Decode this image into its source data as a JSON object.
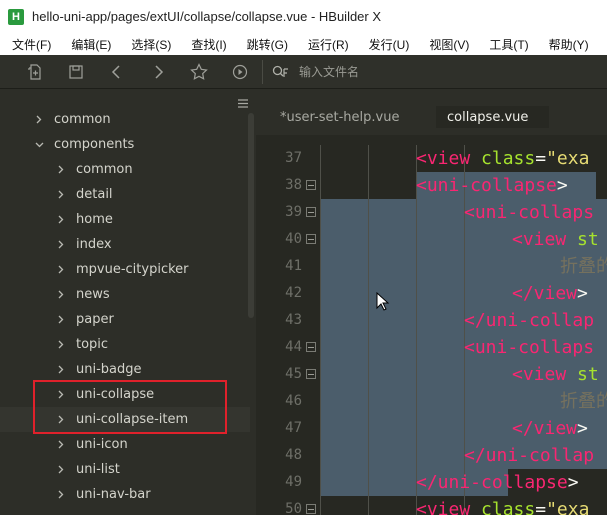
{
  "window": {
    "icon_letter": "H",
    "title": "hello-uni-app/pages/extUI/collapse/collapse.vue - HBuilder X"
  },
  "menu": [
    "文件(F)",
    "编辑(E)",
    "选择(S)",
    "查找(I)",
    "跳转(G)",
    "运行(R)",
    "发行(U)",
    "视图(V)",
    "工具(T)",
    "帮助(Y)"
  ],
  "toolbar": {
    "icons": [
      "new-file-icon",
      "save-icon",
      "back-icon",
      "forward-icon",
      "favorite-star-icon",
      "run-icon",
      "search-file-icon"
    ],
    "search_placeholder": "输入文件名"
  },
  "sidebar": {
    "tree": [
      {
        "label": "common",
        "level": 0,
        "expanded": false
      },
      {
        "label": "components",
        "level": 0,
        "expanded": true
      },
      {
        "label": "common",
        "level": 1,
        "expanded": false
      },
      {
        "label": "detail",
        "level": 1,
        "expanded": false
      },
      {
        "label": "home",
        "level": 1,
        "expanded": false
      },
      {
        "label": "index",
        "level": 1,
        "expanded": false
      },
      {
        "label": "mpvue-citypicker",
        "level": 1,
        "expanded": false
      },
      {
        "label": "news",
        "level": 1,
        "expanded": false
      },
      {
        "label": "paper",
        "level": 1,
        "expanded": false
      },
      {
        "label": "topic",
        "level": 1,
        "expanded": false
      },
      {
        "label": "uni-badge",
        "level": 1,
        "expanded": false
      },
      {
        "label": "uni-collapse",
        "level": 1,
        "expanded": false
      },
      {
        "label": "uni-collapse-item",
        "level": 1,
        "expanded": false
      },
      {
        "label": "uni-icon",
        "level": 1,
        "expanded": false
      },
      {
        "label": "uni-list",
        "level": 1,
        "expanded": false
      },
      {
        "label": "uni-nav-bar",
        "level": 1,
        "expanded": false
      }
    ],
    "highlight_color": "#e0212b"
  },
  "editor": {
    "tabs": [
      {
        "label": "*user-set-help.vue",
        "active": false
      },
      {
        "label": "collapse.vue",
        "active": true
      }
    ],
    "lines": [
      {
        "num": "37",
        "fold": false,
        "indent": 2,
        "parts": [
          [
            "tag",
            "<view "
          ],
          [
            "attr",
            "class"
          ],
          [
            "eq",
            "="
          ],
          [
            "str",
            "\"exa"
          ]
        ]
      },
      {
        "num": "38",
        "fold": true,
        "indent": 2,
        "parts": [
          [
            "tag",
            "<uni-collapse"
          ],
          [
            "eq",
            ">"
          ]
        ]
      },
      {
        "num": "39",
        "fold": true,
        "indent": 3,
        "parts": [
          [
            "tag",
            "<uni-collaps"
          ]
        ]
      },
      {
        "num": "40",
        "fold": true,
        "indent": 4,
        "parts": [
          [
            "tag",
            "<view "
          ],
          [
            "attr",
            "st"
          ]
        ]
      },
      {
        "num": "41",
        "fold": false,
        "indent": 5,
        "parts": [
          [
            "cn",
            "折叠的"
          ]
        ]
      },
      {
        "num": "42",
        "fold": false,
        "indent": 4,
        "parts": [
          [
            "tag",
            "</view"
          ],
          [
            "eq",
            ">"
          ]
        ]
      },
      {
        "num": "43",
        "fold": false,
        "indent": 3,
        "parts": [
          [
            "tag",
            "</uni-collap"
          ]
        ]
      },
      {
        "num": "44",
        "fold": true,
        "indent": 3,
        "parts": [
          [
            "tag",
            "<uni-collaps"
          ]
        ]
      },
      {
        "num": "45",
        "fold": true,
        "indent": 4,
        "parts": [
          [
            "tag",
            "<view "
          ],
          [
            "attr",
            "st"
          ]
        ]
      },
      {
        "num": "46",
        "fold": false,
        "indent": 5,
        "parts": [
          [
            "cn",
            "折叠的"
          ]
        ]
      },
      {
        "num": "47",
        "fold": false,
        "indent": 4,
        "parts": [
          [
            "tag",
            "</view"
          ],
          [
            "eq",
            ">"
          ]
        ]
      },
      {
        "num": "48",
        "fold": false,
        "indent": 3,
        "parts": [
          [
            "tag",
            "</uni-collap"
          ]
        ]
      },
      {
        "num": "49",
        "fold": false,
        "indent": 2,
        "parts": [
          [
            "tag",
            "</uni-collapse"
          ],
          [
            "eq",
            ">"
          ]
        ]
      },
      {
        "num": "50",
        "fold": true,
        "indent": 2,
        "parts": [
          [
            "tag",
            "<view "
          ],
          [
            "attr",
            "class"
          ],
          [
            "eq",
            "="
          ],
          [
            "str",
            "\"exa"
          ]
        ]
      }
    ],
    "colors": {
      "background": "#272822",
      "selection": "#4b5d6b",
      "tag": "#f92672",
      "attribute": "#a6e22e",
      "string": "#e6db74"
    }
  }
}
